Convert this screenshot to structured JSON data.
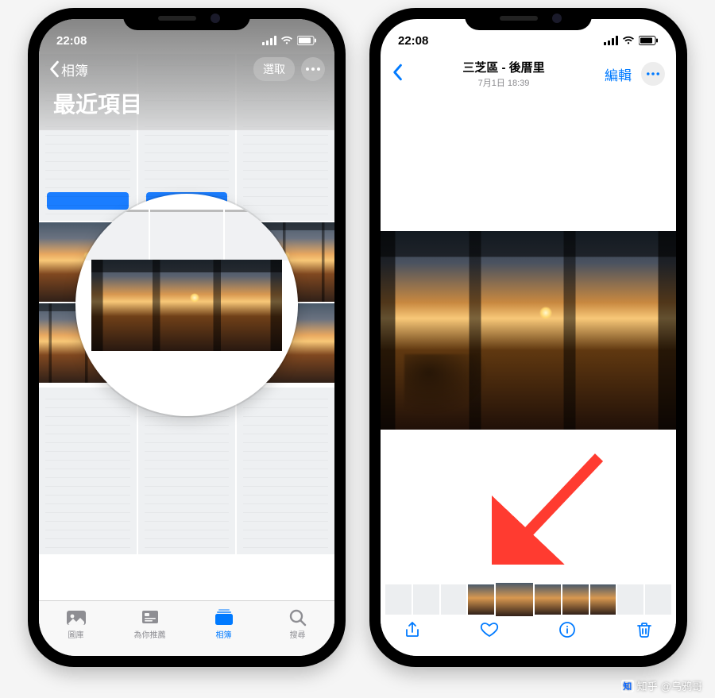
{
  "status": {
    "time": "22:08"
  },
  "left": {
    "back_label": "相簿",
    "title": "最近項目",
    "select_label": "選取",
    "tabs": {
      "library": "圖庫",
      "for_you": "為你推薦",
      "albums": "相簿",
      "search": "搜尋"
    }
  },
  "right": {
    "location": "三芝區 - 後厝里",
    "datetime": "7月1日  18:39",
    "edit_label": "編輯"
  },
  "watermark": {
    "site": "知乎",
    "author": "@乌鸦哥"
  }
}
